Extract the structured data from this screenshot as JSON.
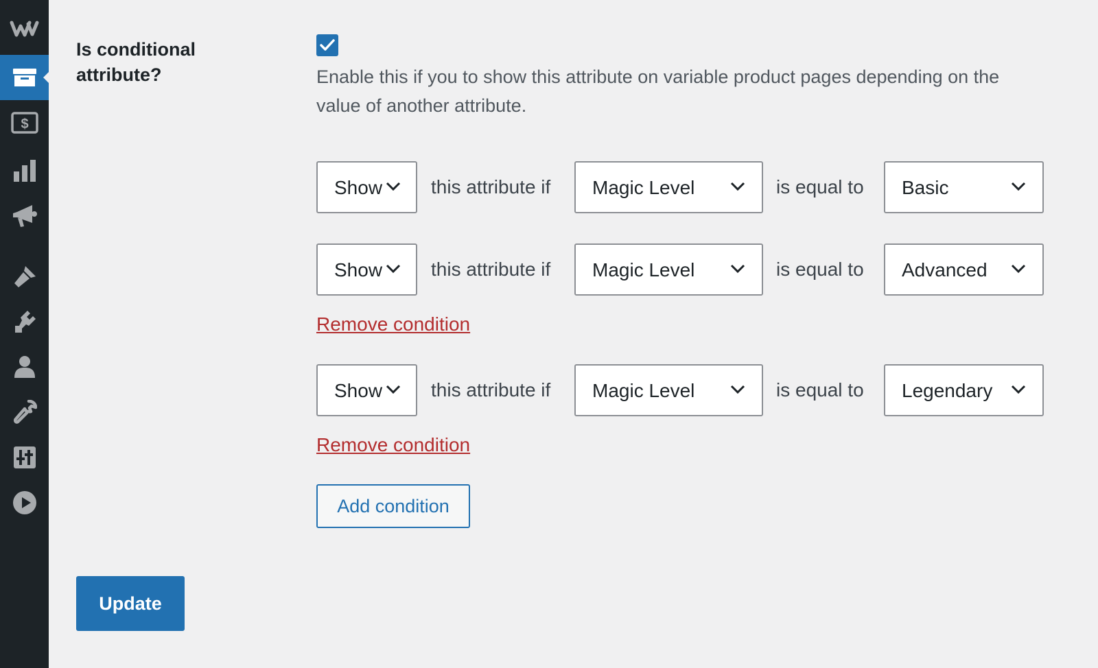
{
  "sidebar": {
    "items": [
      {
        "icon": "woocommerce-logo-icon"
      },
      {
        "icon": "archive-products-icon",
        "active": true
      },
      {
        "icon": "payments-icon"
      },
      {
        "icon": "analytics-icon"
      },
      {
        "icon": "marketing-megaphone-icon"
      },
      {
        "icon": "appearance-brush-icon"
      },
      {
        "icon": "plugins-icon"
      },
      {
        "icon": "users-icon"
      },
      {
        "icon": "tools-wrench-icon"
      },
      {
        "icon": "settings-sliders-icon"
      },
      {
        "icon": "media-play-icon"
      }
    ]
  },
  "field": {
    "label": "Is conditional attribute?",
    "checked": true,
    "description": "Enable this if you to show this attribute on variable product pages depending on the value of another attribute."
  },
  "conditions": [
    {
      "action": "Show",
      "connector": "this attribute if",
      "attribute": "Magic Level",
      "operator": "is equal to",
      "value": "Basic",
      "remove_label": ""
    },
    {
      "action": "Show",
      "connector": "this attribute if",
      "attribute": "Magic Level",
      "operator": "is equal to",
      "value": "Advanced",
      "remove_label": "Remove condition"
    },
    {
      "action": "Show",
      "connector": "this attribute if",
      "attribute": "Magic Level",
      "operator": "is equal to",
      "value": "Legendary",
      "remove_label": "Remove condition"
    }
  ],
  "buttons": {
    "add_condition": "Add condition",
    "update": "Update"
  },
  "colors": {
    "sidebar_bg": "#1d2327",
    "accent": "#2271b1",
    "danger": "#b32d2e",
    "page_bg": "#f0f0f1"
  }
}
